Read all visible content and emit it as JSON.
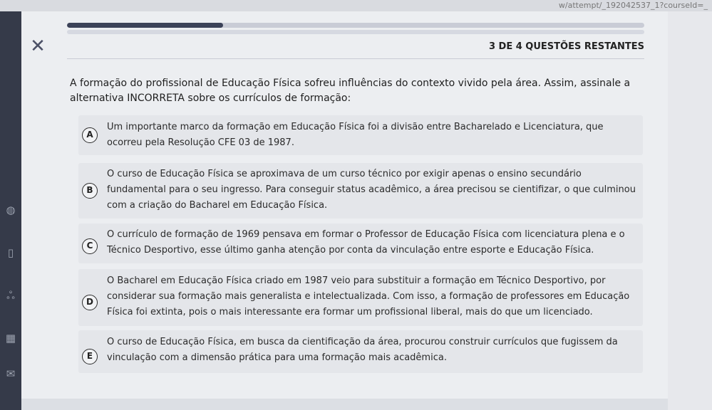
{
  "browser": {
    "url_fragment": "w/attempt/_192042537_1?courseId=_"
  },
  "header": {
    "close_glyph": "✕",
    "remaining_label": "3 DE 4 QUESTÕES RESTANTES",
    "progress_fraction": 0.27
  },
  "question": {
    "prompt": "A formação do profissional de Educação Física sofreu influências do contexto vivido pela área. Assim, assinale a alternativa INCORRETA sobre os currículos de formação:"
  },
  "options": [
    {
      "letter": "A",
      "text": "Um importante marco da formação em Educação Física foi a divisão entre Bacharelado e Licenciatura, que ocorreu pela Resolução CFE 03 de 1987."
    },
    {
      "letter": "B",
      "text": "O curso de Educação Física se aproximava de um curso técnico por exigir apenas o ensino secundário fundamental para o seu ingresso. Para conseguir status acadêmico, a área precisou se cientifizar, o que culminou com a criação do Bacharel em Educação Física."
    },
    {
      "letter": "C",
      "text": "O currículo de formação de 1969 pensava em formar o Professor de Educação Física com licenciatura plena e o Técnico Desportivo, esse último ganha atenção por conta da vinculação entre esporte e Educação Física."
    },
    {
      "letter": "D",
      "text": "O Bacharel em Educação Física criado em 1987 veio para substituir a formação em Técnico Desportivo, por considerar sua formação mais generalista e intelectualizada. Com isso, a formação de professores em Educação Física foi extinta, pois o mais interessante era formar um profissional liberal, mais do que um licenciado."
    },
    {
      "letter": "E",
      "text": "O curso de Educação Física, em busca da cientificação da área, procurou construir currículos que fugissem da vinculação com a dimensão prática para uma formação mais acadêmica."
    }
  ],
  "colors": {
    "progress": "#3b4258",
    "sheet": "#eceef1",
    "option_bg": "#e4e6ea"
  }
}
